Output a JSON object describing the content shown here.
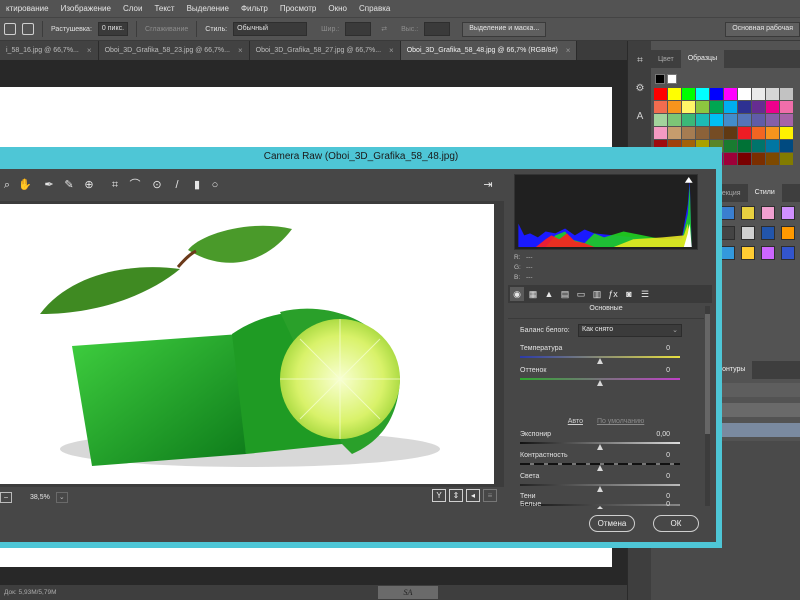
{
  "menu": [
    "ктирование",
    "Изображение",
    "Слои",
    "Текст",
    "Выделение",
    "Фильтр",
    "Просмотр",
    "Окно",
    "Справка"
  ],
  "options": {
    "feather_label": "Растушевка:",
    "feather_value": "0 пикс.",
    "antialias": "Сглаживание",
    "style_label": "Стиль:",
    "style_value": "Обычный",
    "width_label": "Шир.:",
    "height_label": "Выс.:",
    "select_mask_button": "Выделение и маска...",
    "workspace": "Основная рабочая"
  },
  "tabs": [
    {
      "label": "i_58_16.jpg @ 66,7%...",
      "active": false
    },
    {
      "label": "Oboi_3D_Grafika_58_23.jpg @ 66,7%...",
      "active": false
    },
    {
      "label": "Oboi_3D_Grafika_58_27.jpg @ 66,7%...",
      "active": false
    },
    {
      "label": "Oboi_3D_Grafika_58_48.jpg @ 66,7% (RGB/8#)",
      "active": true
    }
  ],
  "status": {
    "doc": "Док: 5,93M/5,79M",
    "signature": "SA"
  },
  "panels": {
    "color_tab": "Цвет",
    "swatches_tab": "Образцы",
    "correction_tab": "рекция",
    "styles_tab": "Стили",
    "contours_tab": "Контуры"
  },
  "swatch_colors": [
    "#ff0000",
    "#ffff00",
    "#00ff00",
    "#00ffff",
    "#0000ff",
    "#ff00ff",
    "#ffffff",
    "#ebebeb",
    "#d6d6d6",
    "#c2c2c2",
    "#f26c4f",
    "#f7941d",
    "#fff568",
    "#8dc73f",
    "#00a651",
    "#00aeef",
    "#2e3192",
    "#662d91",
    "#ec008c",
    "#f06eaa",
    "#a3d39c",
    "#7cc576",
    "#3bb878",
    "#1cbbb4",
    "#00bff3",
    "#438ccb",
    "#5574b9",
    "#605ca8",
    "#855fa8",
    "#a763a8",
    "#f49ac2",
    "#c69c6d",
    "#a67c52",
    "#8c6239",
    "#754c24",
    "#603913",
    "#ed1c24",
    "#f26522",
    "#f7941d",
    "#fff200",
    "#9e0b0f",
    "#a0410d",
    "#a3620a",
    "#aba000",
    "#598527",
    "#197b30",
    "#007236",
    "#00746b",
    "#0076a3",
    "#004a80",
    "#003471",
    "#1b1464",
    "#440e62",
    "#630460",
    "#9e005d",
    "#9e0039",
    "#790000",
    "#7b2e00",
    "#7d4900",
    "#827b00"
  ],
  "style_colors": [
    "#3a7fd0",
    "#e8d040",
    "#f0a0d0",
    "#d090ff",
    "#444444",
    "#d0d0d0",
    "#2255aa",
    "#ff9900",
    "#3399dd",
    "#ffcc33",
    "#cc66ff",
    "#3355cc"
  ],
  "camera_raw": {
    "title": "Camera Raw (Oboi_3D_Grafika_58_48.jpg)",
    "r_label": "R:",
    "g_label": "G:",
    "b_label": "B:",
    "r_value": "---",
    "g_value": "---",
    "b_value": "---",
    "section_title": "Основные",
    "wb_label": "Баланс белого:",
    "wb_value": "Как снято",
    "auto_link": "Авто",
    "default_link": "По умолчанию",
    "zoom": "38,5%",
    "ok": "ОК",
    "cancel": "Отмена",
    "sliders": [
      {
        "name": "Температура",
        "value": "0",
        "pos": 0.5
      },
      {
        "name": "Оттенок",
        "value": "0",
        "pos": 0.5
      },
      {
        "name": "Экспонир",
        "value": "0,00",
        "pos": 0.5
      },
      {
        "name": "Контрастность",
        "value": "0",
        "pos": 0.5
      },
      {
        "name": "Света",
        "value": "0",
        "pos": 0.5
      },
      {
        "name": "Тени",
        "value": "0",
        "pos": 0.5
      },
      {
        "name": "Белые",
        "value": "0",
        "pos": 0.5
      }
    ]
  }
}
